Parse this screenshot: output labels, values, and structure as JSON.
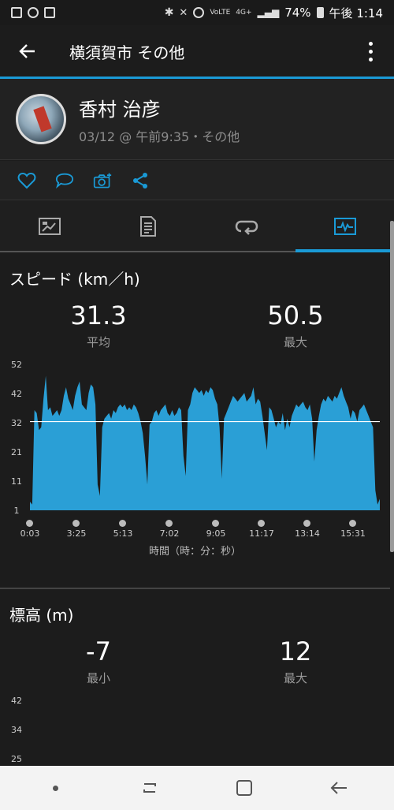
{
  "status_bar": {
    "battery": "74%",
    "time": "午後 1:14",
    "volte": "VoLTE",
    "network": "4G+"
  },
  "app_bar": {
    "title": "横須賀市 その他"
  },
  "profile": {
    "name": "香村 治彦",
    "meta": "03/12 @ 午前9:35・その他"
  },
  "speed": {
    "title": "スピード (km／h)",
    "avg_value": "31.3",
    "avg_label": "平均",
    "max_value": "50.5",
    "max_label": "最大"
  },
  "elevation": {
    "title": "標高 (m)",
    "min_value": "-7",
    "min_label": "最小",
    "max_value": "12",
    "max_label": "最大",
    "y_ticks": [
      "42",
      "34",
      "25"
    ]
  },
  "chart_data": {
    "type": "area",
    "title": "スピード (km／h)",
    "xlabel": "時間（時：分：秒）",
    "ylabel": "",
    "x_ticks": [
      "0:03",
      "3:25",
      "5:13",
      "7:02",
      "9:05",
      "11:17",
      "13:14",
      "15:31"
    ],
    "y_ticks": [
      "52",
      "42",
      "32",
      "21",
      "11",
      "1"
    ],
    "ylim": [
      1,
      52
    ],
    "reference_line": 32,
    "grid": false,
    "color": "#2a9fd6",
    "values": [
      4,
      3,
      36,
      35,
      29,
      30,
      40,
      48,
      36,
      37,
      34,
      35,
      36,
      34,
      36,
      41,
      44,
      40,
      38,
      36,
      41,
      44,
      46,
      38,
      37,
      36,
      42,
      45,
      44,
      38,
      10,
      6,
      30,
      33,
      34,
      35,
      33,
      36,
      35,
      37,
      38,
      37,
      38,
      36,
      37,
      36,
      38,
      37,
      35,
      32,
      28,
      20,
      10,
      31,
      32,
      35,
      36,
      34,
      36,
      37,
      38,
      35,
      34,
      36,
      34,
      35,
      37,
      36,
      20,
      13,
      36,
      38,
      42,
      44,
      43,
      42,
      43,
      41,
      43,
      42,
      44,
      43,
      40,
      38,
      30,
      12,
      33,
      35,
      37,
      39,
      41,
      40,
      39,
      40,
      41,
      42,
      39,
      40,
      41,
      44,
      38,
      40,
      39,
      34,
      28,
      22,
      37,
      36,
      33,
      30,
      32,
      31,
      35,
      29,
      33,
      30,
      34,
      36,
      38,
      37,
      38,
      39,
      37,
      36,
      38,
      33,
      18,
      29,
      34,
      38,
      40,
      39,
      41,
      40,
      39,
      41,
      40,
      42,
      44,
      41,
      39,
      37,
      33,
      36,
      35,
      32,
      36,
      37,
      38,
      36,
      34,
      32,
      30,
      8,
      3,
      5
    ]
  }
}
